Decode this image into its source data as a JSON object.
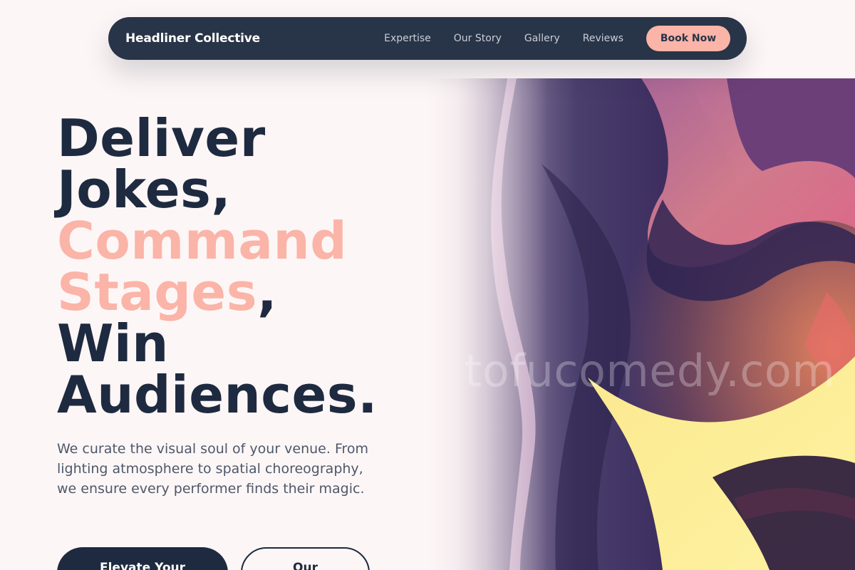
{
  "nav": {
    "brand": "Headliner Collective",
    "links": [
      "Expertise",
      "Our Story",
      "Gallery",
      "Reviews"
    ],
    "cta": "Book Now"
  },
  "hero": {
    "line1": "Deliver",
    "line2": "Jokes,",
    "line3": "Command",
    "line4_accent": "Stages",
    "line4_comma": ",",
    "line5": "Win",
    "line6": "Audiences.",
    "subtext": "We curate the visual soul of your venue. From lighting atmosphere to spatial choreography, we ensure every performer finds their magic.",
    "cta_primary": "Elevate Your",
    "cta_secondary": "Our",
    "watermark": "tofucomedy.com"
  },
  "colors": {
    "nav_bg": "#283447",
    "accent": "#fbb4a8",
    "headline": "#1e2a3f",
    "page_bg": "#fdf6f6"
  }
}
